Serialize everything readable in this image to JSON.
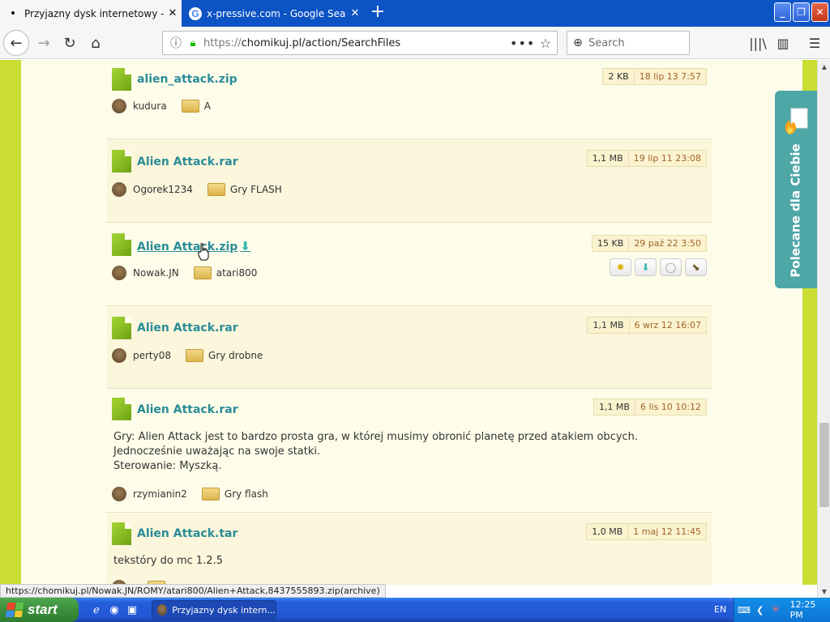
{
  "browser": {
    "tabs": [
      {
        "label": "Przyjazny dysk internetowy - Chomikuj.pl",
        "active": true
      },
      {
        "label": "x-pressive.com - Google Search",
        "active": false
      }
    ],
    "url_prefix": "https://",
    "url_rest": "chomikuj.pl/action/SearchFiles",
    "search_placeholder": "Search",
    "status_url": "https://chomikuj.pl/Nowak.JN/ROMY/atari800/Alien+Attack,8437555893.zip(archive)"
  },
  "results": [
    {
      "name": "alien_attack.zip",
      "size": "2 KB",
      "date": "18 lip 13 7:57",
      "user": "kudura",
      "folder": "A",
      "description": []
    },
    {
      "name": "Alien Attack.rar",
      "size": "1,1 MB",
      "date": "19 lip 11 23:08",
      "user": "Ogorek1234",
      "folder": "Gry FLASH",
      "description": []
    },
    {
      "name": "Alien Attack.zip",
      "size": "15 KB",
      "date": "29 paź 22 3:50",
      "user": "Nowak.JN",
      "folder": "atari800",
      "description": []
    },
    {
      "name": "Alien Attack.rar",
      "size": "1,1 MB",
      "date": "6 wrz 12 16:07",
      "user": "perty08",
      "folder": "Gry drobne",
      "description": []
    },
    {
      "name": "Alien Attack.rar",
      "size": "1,1 MB",
      "date": "6 lis 10 10:12",
      "user": "rzymianin2",
      "folder": "Gry flash",
      "description": [
        "Gry: Alien Attack jest to bardzo prosta gra, w której musimy obronić planetę przed atakiem obcych. Jednocześnie uważając na swoje statki.",
        "Sterowanie: Myszką."
      ]
    },
    {
      "name": "Alien Attack.tar",
      "size": "1,0 MB",
      "date": "1 maj 12 11:45",
      "user": "",
      "folder": "",
      "description": [
        "tekstóry do mc 1.2.5"
      ]
    }
  ],
  "sidebar_tab": {
    "label": "Polecane dla Ciebie"
  },
  "taskbar": {
    "start_label": "start",
    "task_label": "Przyjazny dysk intern...",
    "language": "EN",
    "clock": "12:25 PM"
  },
  "colors": {
    "link": "#2a8c98",
    "date": "#a3622d",
    "page_bg": "#c9dd32",
    "sidebar_tab": "#4ea7a7"
  }
}
